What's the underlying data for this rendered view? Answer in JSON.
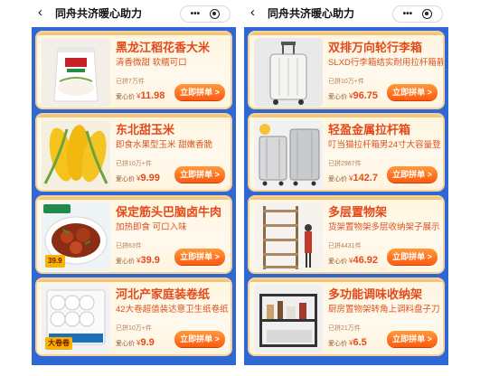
{
  "nav": {
    "back_glyph": "‹",
    "title": "同舟共济暖心助力",
    "more_glyph": "•••"
  },
  "colors": {
    "page_bg": "#2f67d3",
    "accent": "#e34a1b",
    "button": "#ff6a1a"
  },
  "left_column": [
    {
      "name": "黑龙江稻花香大米",
      "desc": "清香微甜 软糯可口",
      "sold": "已拼7万件",
      "price_label": "爱心价",
      "currency": "¥",
      "price": "11.98",
      "button": "立即拼单 >",
      "thumb": "rice-bag"
    },
    {
      "name": "东北甜玉米",
      "desc": "即食水果型玉米 甜嫩香脆",
      "sold": "已拼10万+件",
      "price_label": "爱心价",
      "currency": "¥",
      "price": "9.99",
      "button": "立即拼单 >",
      "thumb": "sweet-corn"
    },
    {
      "name": "保定筋头巴脑卤牛肉",
      "desc": "加热即食 可口入味",
      "sold": "已拼63件",
      "price_label": "爱心价",
      "currency": "¥",
      "price": "39.9",
      "button": "立即拼单 >",
      "thumb": "braised-beef",
      "tag": "39.9"
    },
    {
      "name": "河北产家庭装卷纸",
      "desc": "42大卷超值装达意卫生纸卷纸",
      "sold": "已拼10万+件",
      "price_label": "爱心价",
      "currency": "¥",
      "price": "9.9",
      "button": "立即拼单 >",
      "thumb": "toilet-paper",
      "tag": "大卷卷"
    }
  ],
  "right_column": [
    {
      "name": "双排万向轮行李箱",
      "desc": "SLXD行李箱结实耐用拉杆箱静",
      "sold": "已拼10万+件",
      "price_label": "爱心价",
      "currency": "¥",
      "price": "96.75",
      "button": "立即拼单 >",
      "thumb": "luggage-white"
    },
    {
      "name": "轻盈金属拉杆箱",
      "desc": "叮当猫拉杆箱男24寸大容量登",
      "sold": "已拼2987件",
      "price_label": "爱心价",
      "currency": "¥",
      "price": "142.7",
      "button": "立即拼单 >",
      "thumb": "luggage-silver"
    },
    {
      "name": "多层置物架",
      "desc": "货架置物架多层收纳架子展示",
      "sold": "已拼4431件",
      "price_label": "爱心价",
      "currency": "¥",
      "price": "46.92",
      "button": "立即拼单 >",
      "thumb": "storage-shelf"
    },
    {
      "name": "多功能调味收纳架",
      "desc": "厨房置物架转角上调料盘子刀",
      "sold": "已拼21万件",
      "price_label": "爱心价",
      "currency": "¥",
      "price": "6.5",
      "button": "立即拼单 >",
      "thumb": "spice-rack"
    }
  ]
}
